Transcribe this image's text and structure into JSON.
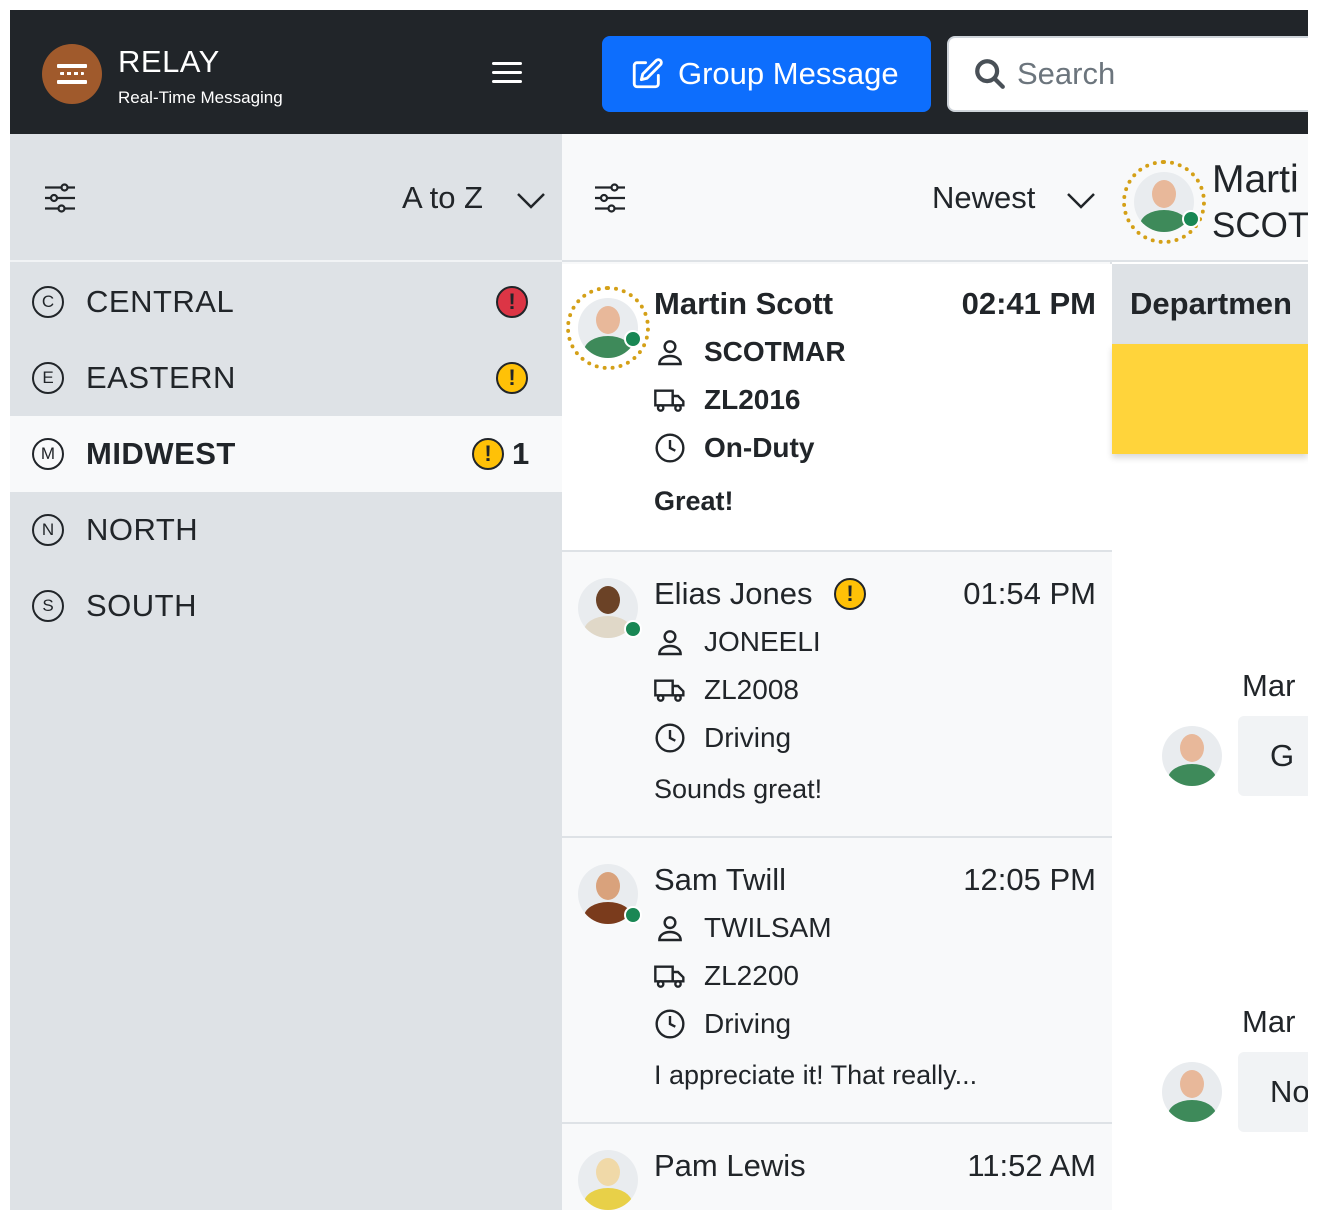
{
  "app": {
    "title": "RELAY",
    "subtitle": "Real-Time Messaging",
    "logo_icon": "relay-logo-icon",
    "menu_icon": "hamburger-menu-icon"
  },
  "toolbar": {
    "group_message_label": "Group Message",
    "search_placeholder": "Search"
  },
  "regions_panel": {
    "sort_label": "A to Z",
    "items": [
      {
        "letter": "C",
        "name": "CENTRAL",
        "alert": "red",
        "count": ""
      },
      {
        "letter": "E",
        "name": "EASTERN",
        "alert": "yellow",
        "count": ""
      },
      {
        "letter": "M",
        "name": "MIDWEST",
        "alert": "yellow",
        "count": "1",
        "active": true
      },
      {
        "letter": "N",
        "name": "NORTH",
        "alert": "",
        "count": ""
      },
      {
        "letter": "S",
        "name": "SOUTH",
        "alert": "",
        "count": ""
      }
    ]
  },
  "conversations_panel": {
    "sort_label": "Newest",
    "items": [
      {
        "name": "Martin Scott",
        "time": "02:41 PM",
        "user_id": "SCOTMAR",
        "truck": "ZL2016",
        "status": "On-Duty",
        "message": "Great!",
        "active": true
      },
      {
        "name": "Elias Jones",
        "time": "01:54 PM",
        "user_id": "JONEELI",
        "truck": "ZL2008",
        "status": "Driving",
        "message": "Sounds great!"
      },
      {
        "name": "Sam Twill",
        "time": "12:05 PM",
        "user_id": "TWILSAM",
        "truck": "ZL2200",
        "status": "Driving",
        "message": "I appreciate it! That really..."
      },
      {
        "name": "Pam Lewis",
        "time": "11:52 AM"
      }
    ]
  },
  "detail_panel": {
    "name": "Marti",
    "user_id": "SCOT",
    "department_label": "Departmen",
    "messages": [
      {
        "sender": "Mar",
        "text": "G"
      },
      {
        "sender": "Mar",
        "text": "No"
      }
    ]
  },
  "colors": {
    "topbar": "#212529",
    "accent": "#0d6efd",
    "alert_red": "#dc3545",
    "alert_yellow": "#ffc107",
    "online": "#198754",
    "highlight": "#ffd43b"
  }
}
